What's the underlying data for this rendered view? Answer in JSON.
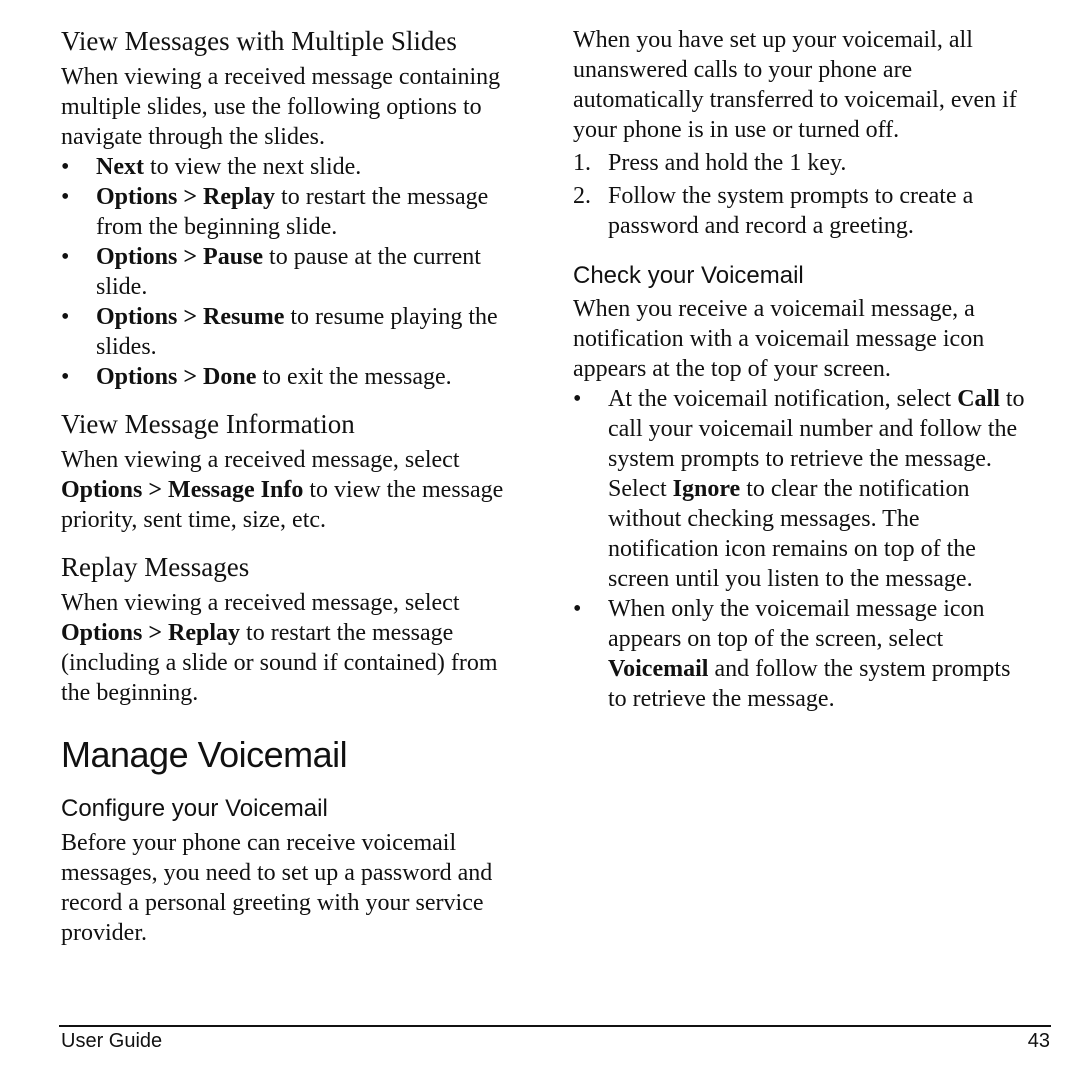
{
  "left_column": {
    "section1": {
      "heading": "View Messages with Multiple Slides",
      "intro_lines": [
        "When viewing a received message containing",
        "multiple slides, use the following options to",
        "navigate through the slides."
      ],
      "bullets": [
        {
          "bold": "Next",
          "rest": " to view the next slide.",
          "cont": ""
        },
        {
          "bold": "Options > Replay",
          "rest": " to restart the message",
          "cont": "from the beginning slide."
        },
        {
          "bold": "Options > Pause",
          "rest": " to pause at the current",
          "cont": "slide."
        },
        {
          "bold": "Options > Resume",
          "rest": " to resume playing the",
          "cont": "slides."
        },
        {
          "bold": "Options > Done",
          "rest": " to exit the message.",
          "cont": ""
        }
      ],
      "bullet_mark": "•"
    },
    "section2": {
      "heading": "View Message Information",
      "line1": "When viewing a received message, select",
      "line2_bold": "Options > Message Info",
      "line2_rest": " to view the message",
      "line3": "priority, sent time, size, etc."
    },
    "section3": {
      "heading": "Replay Messages",
      "line1": "When viewing a received message, select",
      "line2_bold": "Options > Replay",
      "line2_rest": " to restart the message",
      "line3": "(including a slide or sound if contained) from",
      "line4": "the beginning."
    },
    "chapter": {
      "title": "Manage Voicemail"
    },
    "section4": {
      "heading": "Configure your Voicemail",
      "lines": [
        "Before your phone can receive voicemail",
        "messages, you need to set up a password and",
        "record a personal greeting with your service",
        "provider."
      ]
    }
  },
  "right_column": {
    "intro_lines": [
      "When you have set up your voicemail, all",
      "unanswered calls to your phone are",
      "automatically transferred to voicemail, even if",
      "your phone is in use or turned off."
    ],
    "steps": [
      {
        "num": "1.",
        "lines": [
          "Press and hold the 1 key."
        ]
      },
      {
        "num": "2.",
        "lines": [
          "Follow the system prompts to create a",
          "password and record a greeting."
        ]
      }
    ],
    "section5": {
      "heading": "Check your Voicemail",
      "intro_lines": [
        "When you receive a voicemail message, a",
        "notification with a voicemail message icon",
        "appears at the top of your screen."
      ],
      "bullet1": {
        "l1_pre": "At the voicemail notification, select ",
        "l1_bold": "Call",
        "l1_post": " to",
        "l2": "call your voicemail number and follow the",
        "l3": "system prompts to retrieve the message.",
        "l4_pre": "Select ",
        "l4_bold": "Ignore",
        "l4_post": " to clear the notification",
        "l5": "without checking messages. The",
        "l6": "notification icon remains on top of the",
        "l7": "screen until you listen to the message."
      },
      "bullet2": {
        "l1": "When only the voicemail message icon",
        "l2": "appears on top of the screen, select",
        "l3_bold": "Voicemail",
        "l3_post": " and follow the system prompts",
        "l4": "to retrieve the message."
      },
      "bullet_mark": "•"
    }
  },
  "footer": {
    "left": "User Guide",
    "page_number": "43"
  }
}
